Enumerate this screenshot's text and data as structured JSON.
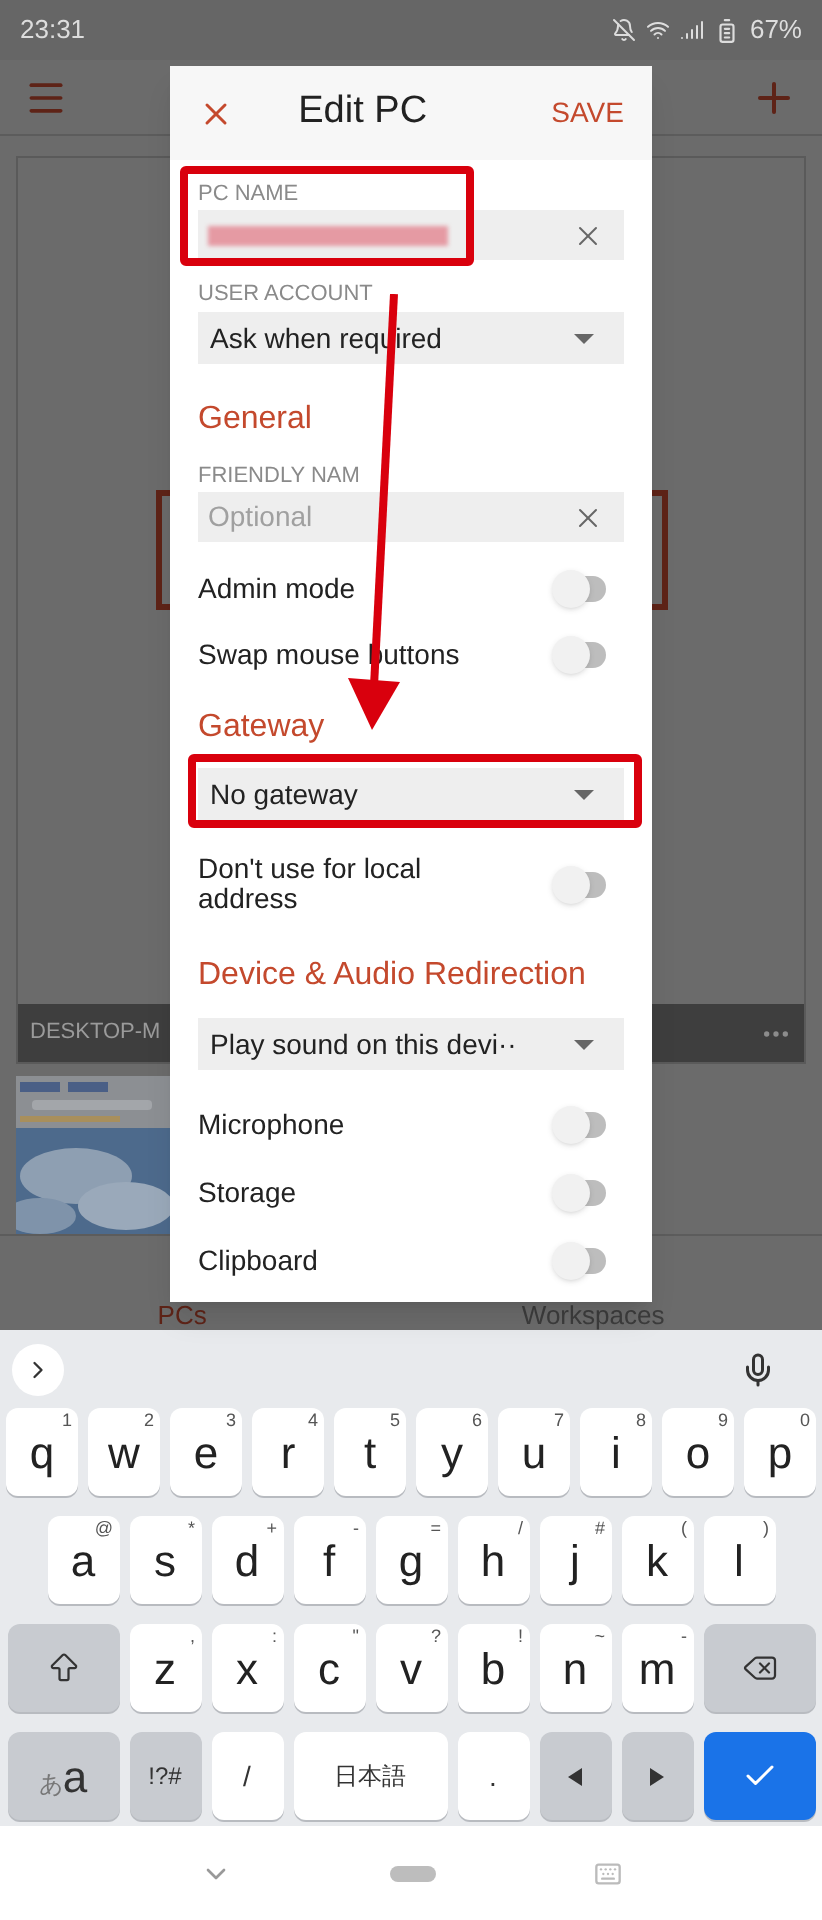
{
  "status_bar": {
    "time": "23:31",
    "battery": "67%"
  },
  "background": {
    "pc_name": "DESKTOP-M",
    "tabs": [
      {
        "label": "PCs",
        "selected": true
      },
      {
        "label": "Workspaces",
        "selected": false
      }
    ]
  },
  "dialog": {
    "title": "Edit PC",
    "save": "SAVE",
    "items": [
      {
        "kind": "field",
        "label": "PC NAME",
        "redacted": true
      },
      {
        "kind": "dropdown",
        "label": "USER ACCOUNT",
        "value": "Ask when required"
      },
      {
        "kind": "heading",
        "text": "General"
      },
      {
        "kind": "field",
        "label": "FRIENDLY NAM",
        "placeholder": "Optional",
        "redacted": false
      },
      {
        "kind": "toggle",
        "label": "Admin mode",
        "on": false
      },
      {
        "kind": "toggle",
        "label": "Swap mouse buttons",
        "on": false
      },
      {
        "kind": "heading",
        "text": "Gateway"
      },
      {
        "kind": "dropdown",
        "value": "No gateway"
      },
      {
        "kind": "toggle",
        "label": "Don't use for local address",
        "on": false
      },
      {
        "kind": "heading",
        "text": "Device & Audio Redirection"
      },
      {
        "kind": "dropdown",
        "value": "Play sound on this devi··"
      },
      {
        "kind": "toggle",
        "label": "Microphone",
        "on": false
      },
      {
        "kind": "toggle",
        "label": "Storage",
        "on": false
      },
      {
        "kind": "toggle",
        "label": "Clipboard",
        "on": false
      }
    ]
  },
  "keyboard": {
    "rows": [
      {
        "keys": [
          {
            "kind": "char",
            "label": "q",
            "hint": "1"
          },
          {
            "kind": "char",
            "label": "w",
            "hint": "2"
          },
          {
            "kind": "char",
            "label": "e",
            "hint": "3"
          },
          {
            "kind": "char",
            "label": "r",
            "hint": "4"
          },
          {
            "kind": "char",
            "label": "t",
            "hint": "5"
          },
          {
            "kind": "char",
            "label": "y",
            "hint": "6"
          },
          {
            "kind": "char",
            "label": "u",
            "hint": "7"
          },
          {
            "kind": "char",
            "label": "i",
            "hint": "8"
          },
          {
            "kind": "char",
            "label": "o",
            "hint": "9"
          },
          {
            "kind": "char",
            "label": "p",
            "hint": "0"
          }
        ]
      },
      {
        "keys": [
          {
            "kind": "char",
            "label": "a",
            "hint": "@"
          },
          {
            "kind": "char",
            "label": "s",
            "hint": "*"
          },
          {
            "kind": "char",
            "label": "d",
            "hint": "+"
          },
          {
            "kind": "char",
            "label": "f",
            "hint": "-"
          },
          {
            "kind": "char",
            "label": "g",
            "hint": "="
          },
          {
            "kind": "char",
            "label": "h",
            "hint": "/"
          },
          {
            "kind": "char",
            "label": "j",
            "hint": "#"
          },
          {
            "kind": "char",
            "label": "k",
            "hint": "("
          },
          {
            "kind": "char",
            "label": "l",
            "hint": ")"
          }
        ]
      },
      {
        "keys": [
          {
            "kind": "shift"
          },
          {
            "kind": "char",
            "label": "z",
            "hint": ","
          },
          {
            "kind": "char",
            "label": "x",
            "hint": ":"
          },
          {
            "kind": "char",
            "label": "c",
            "hint": "\""
          },
          {
            "kind": "char",
            "label": "v",
            "hint": "?"
          },
          {
            "kind": "char",
            "label": "b",
            "hint": "!"
          },
          {
            "kind": "char",
            "label": "n",
            "hint": "~"
          },
          {
            "kind": "char",
            "label": "m",
            "hint": "-"
          },
          {
            "kind": "backspace"
          }
        ]
      },
      {
        "keys": [
          {
            "kind": "mode",
            "small": "あ",
            "label": "a"
          },
          {
            "kind": "symbols",
            "label": "!?#"
          },
          {
            "kind": "plain",
            "label": "/"
          },
          {
            "kind": "space",
            "label": "日本語"
          },
          {
            "kind": "plain",
            "label": "."
          },
          {
            "kind": "left"
          },
          {
            "kind": "right"
          },
          {
            "kind": "enter"
          }
        ]
      }
    ]
  }
}
